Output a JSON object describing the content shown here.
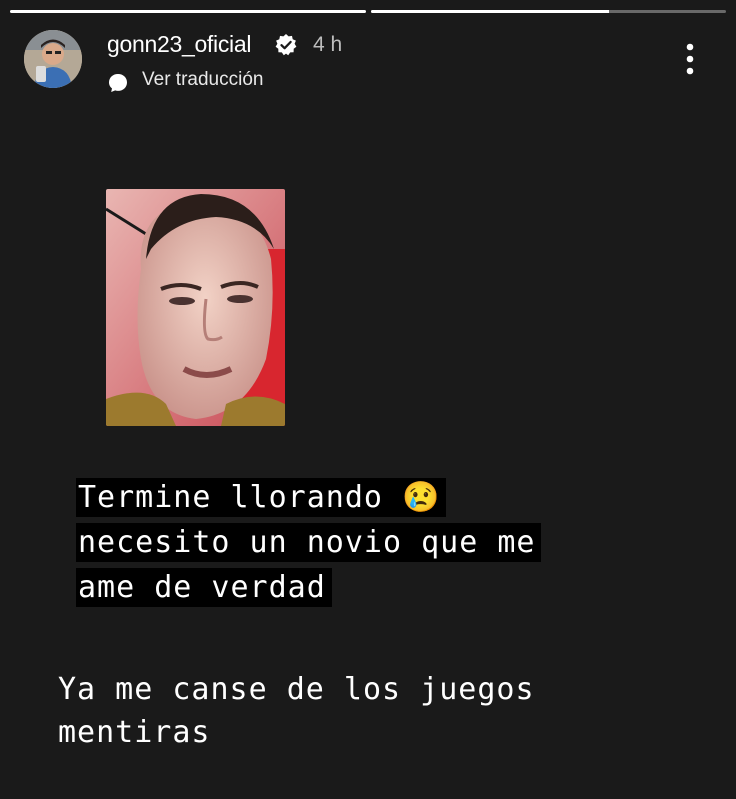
{
  "story": {
    "progress": [
      1,
      0.67
    ],
    "username": "gonn23_oficial",
    "time": "4 h",
    "translate_label": "Ver traducción",
    "caption_lines": [
      "Termine llorando 😢",
      "necesito un novio que me",
      "ame de verdad"
    ],
    "text_lines": [
      "Ya me canse de los juegos",
      "mentiras"
    ]
  },
  "icons": {
    "verified": "verified-badge-icon",
    "translate": "translate-bubble-icon",
    "more": "more-options-icon"
  }
}
